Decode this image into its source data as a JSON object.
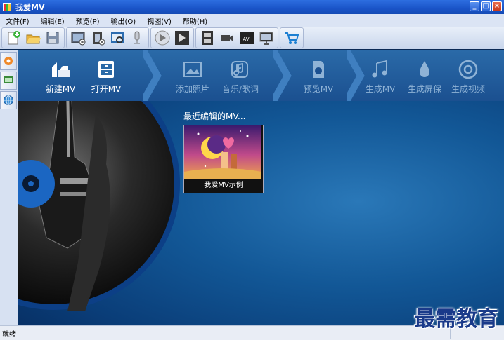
{
  "window": {
    "title": "我爱MV"
  },
  "menu": [
    {
      "label": "文件(F)"
    },
    {
      "label": "编辑(E)"
    },
    {
      "label": "预览(P)"
    },
    {
      "label": "输出(O)"
    },
    {
      "label": "视图(V)"
    },
    {
      "label": "帮助(H)"
    }
  ],
  "toolbar": {
    "icons": [
      "new-doc-icon",
      "open-folder-icon",
      "save-icon",
      "add-photo-icon",
      "add-video-icon",
      "edit-photo-icon",
      "microphone-icon",
      "play-icon",
      "play-next-icon",
      "film-icon",
      "camera-icon",
      "avi-icon",
      "monitor-icon",
      "cart-icon"
    ]
  },
  "steps": [
    {
      "label": "新建MV",
      "icon": "new-mv-icon",
      "enabled": true
    },
    {
      "label": "打开MV",
      "icon": "open-mv-icon",
      "enabled": true
    },
    {
      "label": "添加照片",
      "icon": "add-photo-icon",
      "enabled": false
    },
    {
      "label": "音乐/歌词",
      "icon": "music-lyrics-icon",
      "enabled": false
    },
    {
      "label": "预览MV",
      "icon": "preview-icon",
      "enabled": false
    },
    {
      "label": "生成MV",
      "icon": "music-note-icon",
      "enabled": false
    },
    {
      "label": "生成屏保",
      "icon": "drop-icon",
      "enabled": false
    },
    {
      "label": "生成视频",
      "icon": "disc-icon",
      "enabled": false
    }
  ],
  "recent": {
    "title": "最近编辑的MV...",
    "items": [
      {
        "caption": "我爱MV示例"
      }
    ]
  },
  "status": {
    "text": "就绪"
  },
  "watermark": "最需教育",
  "colors": {
    "accent": "#1b5090",
    "text_enabled": "#ffffff",
    "text_disabled": "#8fb3d6"
  }
}
